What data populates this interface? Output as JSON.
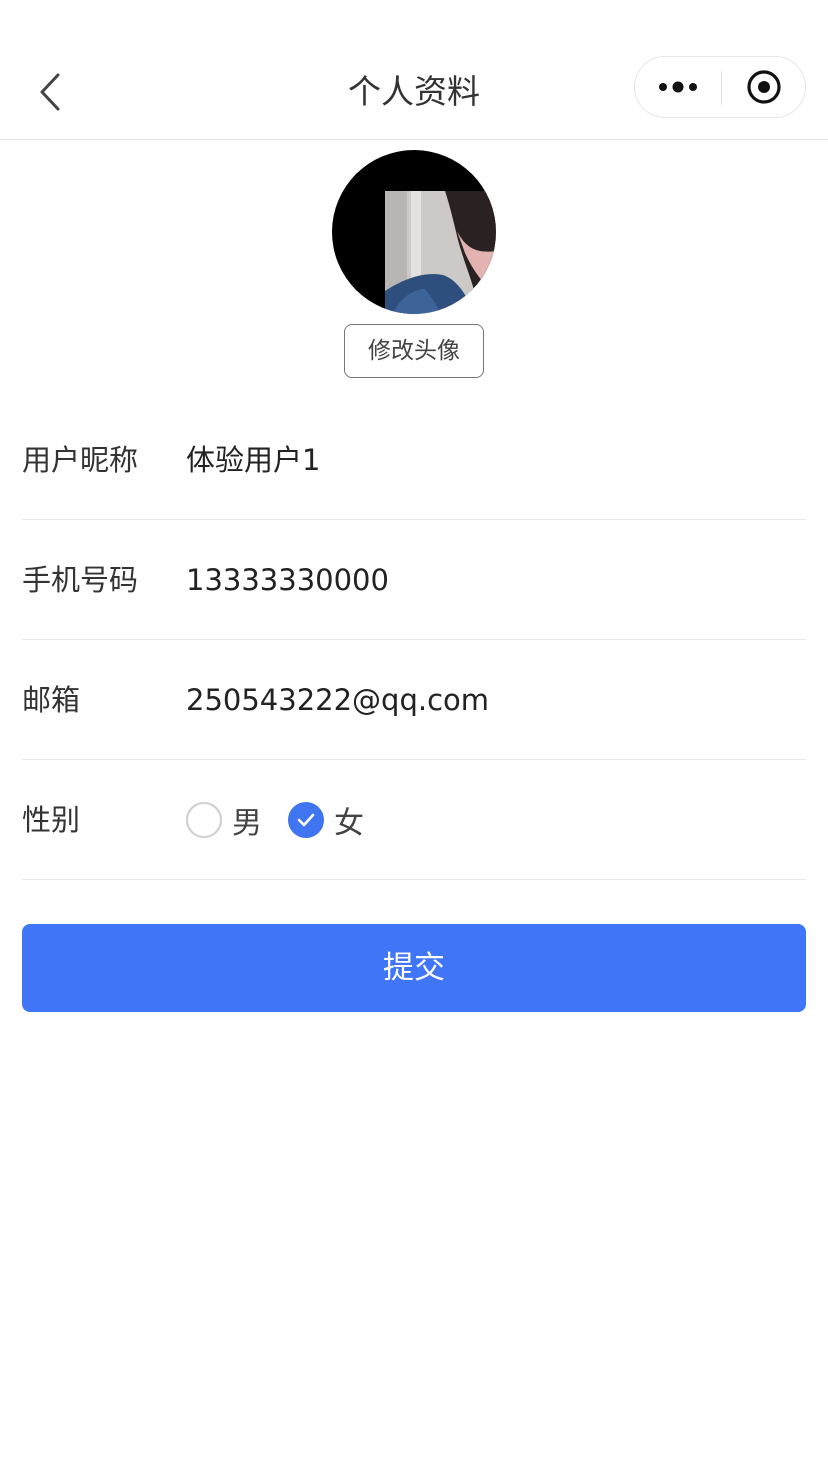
{
  "nav": {
    "title": "个人资料",
    "back_icon": "chevron-left-icon",
    "more_icon": "more-dots-icon",
    "close_icon": "target-circle-icon"
  },
  "profile": {
    "change_avatar_label": "修改头像"
  },
  "form": {
    "nickname": {
      "label": "用户昵称",
      "value": "体验用户1"
    },
    "phone": {
      "label": "手机号码",
      "value": "13333330000"
    },
    "email": {
      "label": "邮箱",
      "value": "250543222@qq.com"
    },
    "gender": {
      "label": "性别",
      "options": [
        {
          "label": "男",
          "checked": false
        },
        {
          "label": "女",
          "checked": true
        }
      ]
    }
  },
  "submit_label": "提交",
  "colors": {
    "accent": "#3f75f6",
    "divider": "#e8e8e8"
  }
}
